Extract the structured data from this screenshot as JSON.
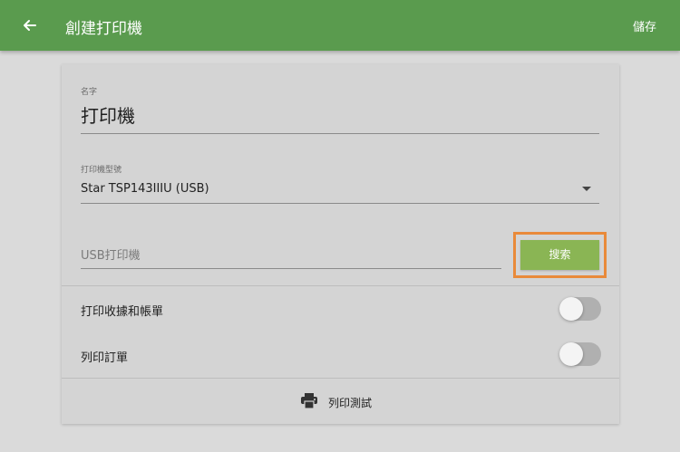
{
  "appbar": {
    "title": "創建打印機",
    "save_label": "儲存",
    "back_icon": "arrow-left-icon"
  },
  "form": {
    "name_label": "名字",
    "name_value": "打印機",
    "model_label": "打印機型號",
    "model_value": "Star TSP143IIIU (USB)",
    "usb_placeholder": "USB打印機",
    "search_label": "搜索"
  },
  "options": [
    {
      "label": "打印收據和帳單",
      "enabled": false
    },
    {
      "label": "列印訂單",
      "enabled": false
    }
  ],
  "print_test": {
    "label": "列印測試",
    "icon": "printer-icon"
  },
  "colors": {
    "appbar": "#5a9b4e",
    "search_button": "#8ab554",
    "highlight": "#e98a3a"
  }
}
